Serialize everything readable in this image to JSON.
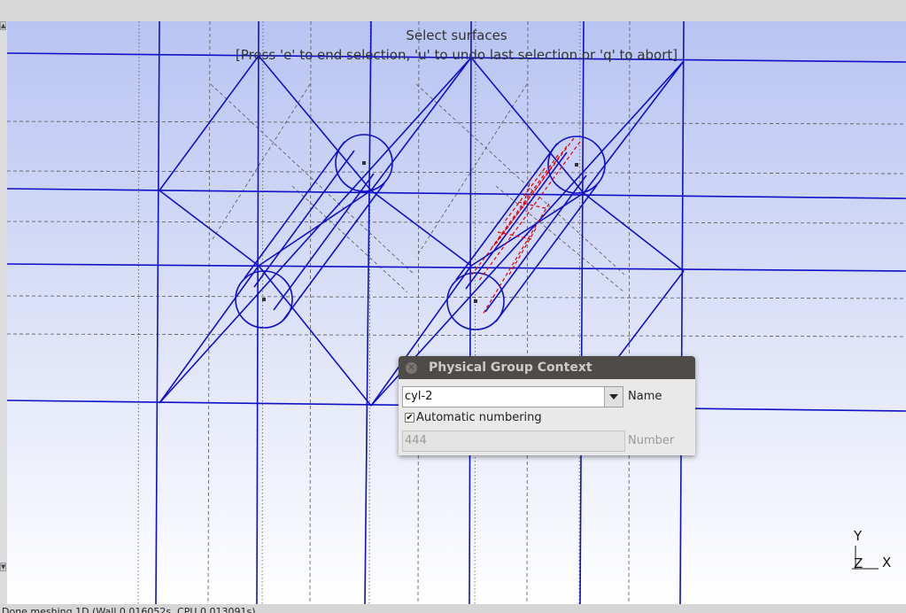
{
  "viewport": {
    "message_line1": "Select surfaces",
    "message_line2": "[Press 'e' to end selection, 'u' to undo last selection or 'q' to abort]",
    "axis_y": "Y",
    "axis_z": "Z",
    "axis_x": "X",
    "line_color": "#1010c8",
    "highlight_color": "#e00000",
    "gradient_top": "#b8c4f2",
    "gradient_bottom": "#ffffff"
  },
  "dialog": {
    "title": "Physical Group Context",
    "name_value": "cyl-2",
    "name_label": "Name",
    "auto_numbering_label": "Automatic numbering",
    "auto_numbering_checked": true,
    "number_value": "444",
    "number_label": "Number"
  },
  "statusbar": {
    "text": "Done meshing 1D (Wall 0.016052s, CPU 0.013091s)"
  }
}
